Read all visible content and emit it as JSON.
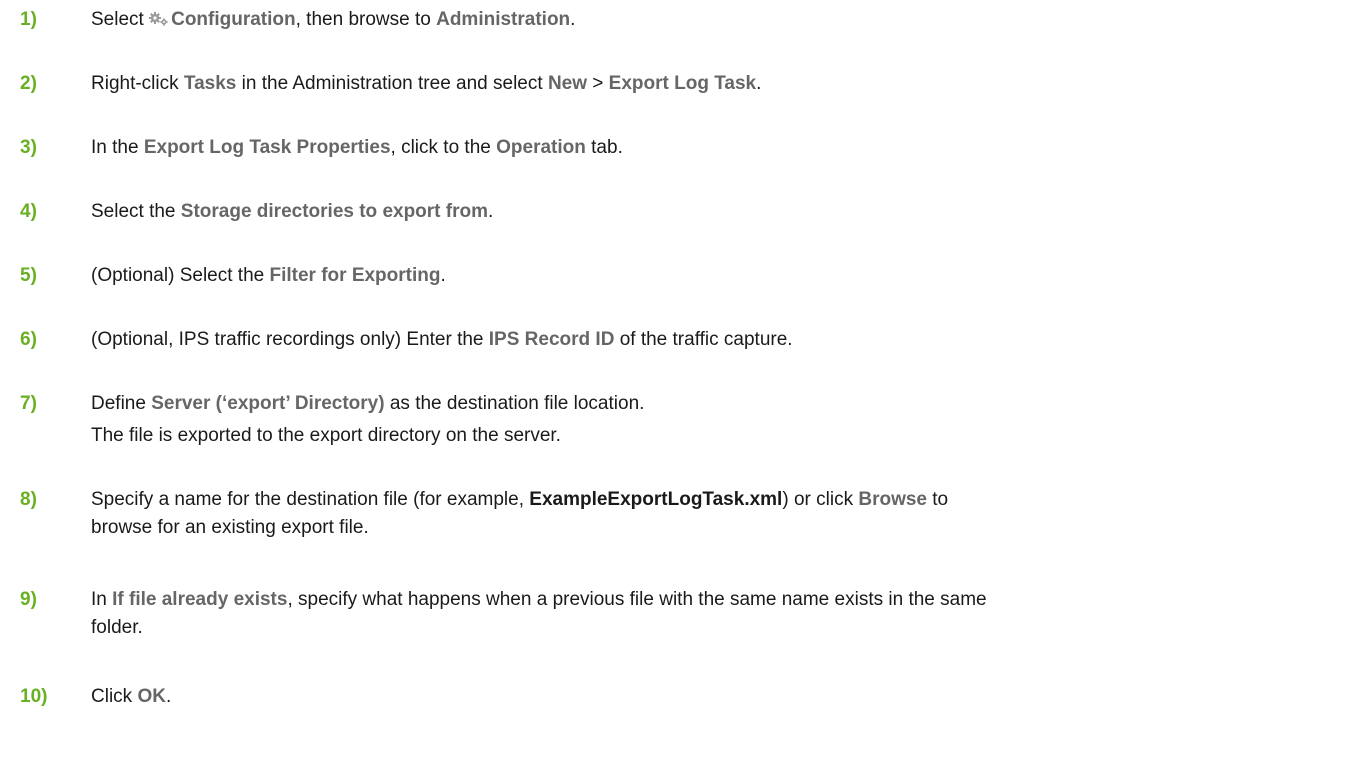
{
  "steps": [
    {
      "num": "1)",
      "parts": [
        "Select ",
        "Configuration",
        ", then browse to ",
        "Administration",
        "."
      ]
    },
    {
      "num": "2)",
      "parts": [
        "Right-click ",
        "Tasks",
        " in the Administration tree and select ",
        "New",
        " > ",
        "Export Log Task",
        "."
      ]
    },
    {
      "num": "3)",
      "parts": [
        "In the ",
        "Export Log Task Properties",
        ", click to the ",
        "Operation",
        " tab."
      ]
    },
    {
      "num": "4)",
      "parts": [
        "Select the ",
        "Storage directories to export from",
        "."
      ]
    },
    {
      "num": "5)",
      "parts": [
        "(Optional) Select the ",
        "Filter for Exporting",
        "."
      ]
    },
    {
      "num": "6)",
      "parts": [
        "(Optional, IPS traffic recordings only) Enter the ",
        "IPS Record ID",
        " of the traffic capture."
      ]
    },
    {
      "num": "7)",
      "parts": [
        "Define ",
        "Server (‘export’ Directory)",
        " as the destination file location."
      ],
      "note": "The file is exported to the export directory on the server."
    },
    {
      "num": "8)",
      "parts": [
        "Specify a name for the destination file (for example, ",
        "ExampleExportLogTask.xml",
        ") or click ",
        "Browse",
        " to"
      ],
      "continuation": "browse for an existing export file."
    },
    {
      "num": "9)",
      "parts": [
        "In ",
        "If file already exists",
        ", specify what happens when a previous file with the same name exists in the same"
      ],
      "continuation": "folder."
    },
    {
      "num": "10)",
      "parts": [
        "Click ",
        "OK",
        "."
      ]
    }
  ]
}
